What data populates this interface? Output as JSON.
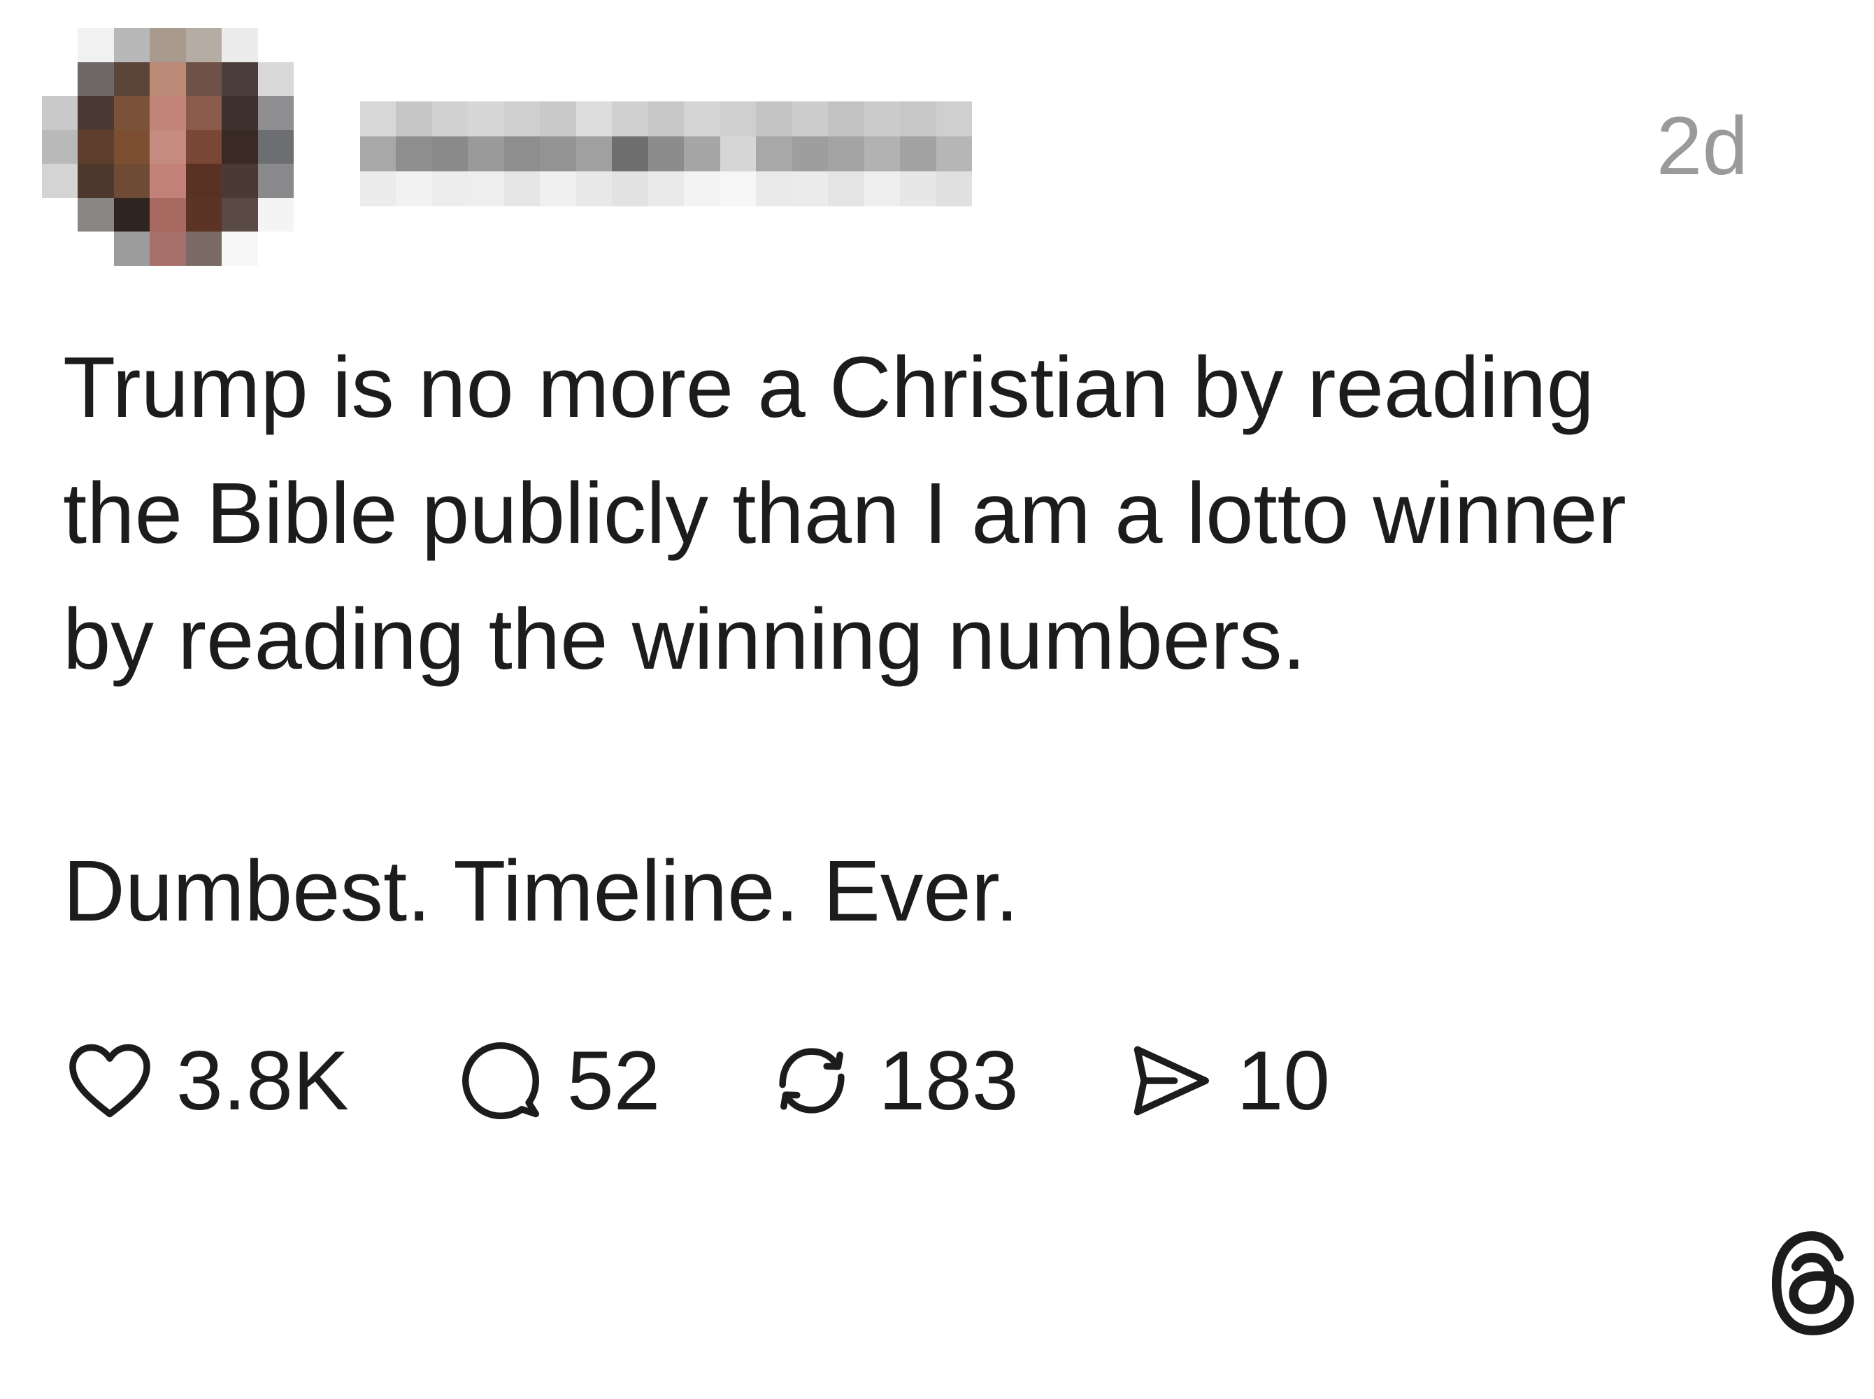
{
  "post": {
    "timestamp": "2d",
    "body_lines": [
      "Trump is no more a Christian by reading",
      "the Bible publicly than I am a lotto winner",
      "by reading the winning numbers."
    ],
    "body_second_paragraph": "Dumbest. Timeline. Ever.",
    "actions": {
      "likes": "3.8K",
      "replies": "52",
      "reposts": "183",
      "shares": "10"
    }
  },
  "icons": {
    "like": "heart-icon",
    "reply": "comment-bubble-icon",
    "repost": "repost-icon",
    "share": "send-icon",
    "brand": "threads-logo-icon"
  },
  "colors": {
    "text": "#1c1c1c",
    "muted": "#9a9a9a",
    "background": "#ffffff"
  }
}
